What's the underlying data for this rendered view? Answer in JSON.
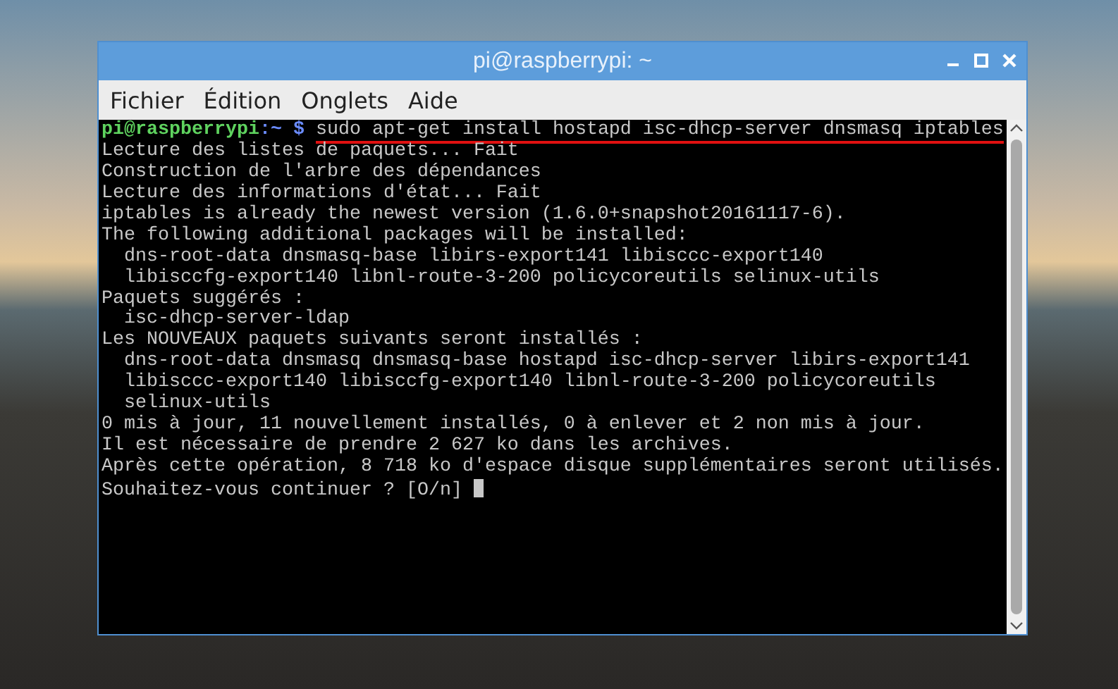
{
  "window": {
    "title": "pi@raspberrypi: ~"
  },
  "menu": [
    "Fichier",
    "Édition",
    "Onglets",
    "Aide"
  ],
  "terminal": {
    "prompt": {
      "user_host": "pi@raspberrypi",
      "path": ":~",
      "symbol": "$",
      "command": "sudo apt-get install hostapd isc-dhcp-server dnsmasq iptables",
      "underlined": true
    },
    "lines": [
      "Lecture des listes de paquets... Fait",
      "Construction de l'arbre des dépendances",
      "Lecture des informations d'état... Fait",
      "iptables is already the newest version (1.6.0+snapshot20161117-6).",
      "The following additional packages will be installed:",
      "  dns-root-data dnsmasq-base libirs-export141 libisccc-export140",
      "  libisccfg-export140 libnl-route-3-200 policycoreutils selinux-utils",
      "Paquets suggérés :",
      "  isc-dhcp-server-ldap",
      "Les NOUVEAUX paquets suivants seront installés :",
      "  dns-root-data dnsmasq dnsmasq-base hostapd isc-dhcp-server libirs-export141",
      "  libisccc-export140 libisccfg-export140 libnl-route-3-200 policycoreutils",
      "  selinux-utils",
      "0 mis à jour, 11 nouvellement installés, 0 à enlever et 2 non mis à jour.",
      "Il est nécessaire de prendre 2 627 ko dans les archives.",
      "Après cette opération, 8 718 ko d'espace disque supplémentaires seront utilisés."
    ],
    "question": "Souhaitez-vous continuer ? [O/n]",
    "cursor": true
  }
}
